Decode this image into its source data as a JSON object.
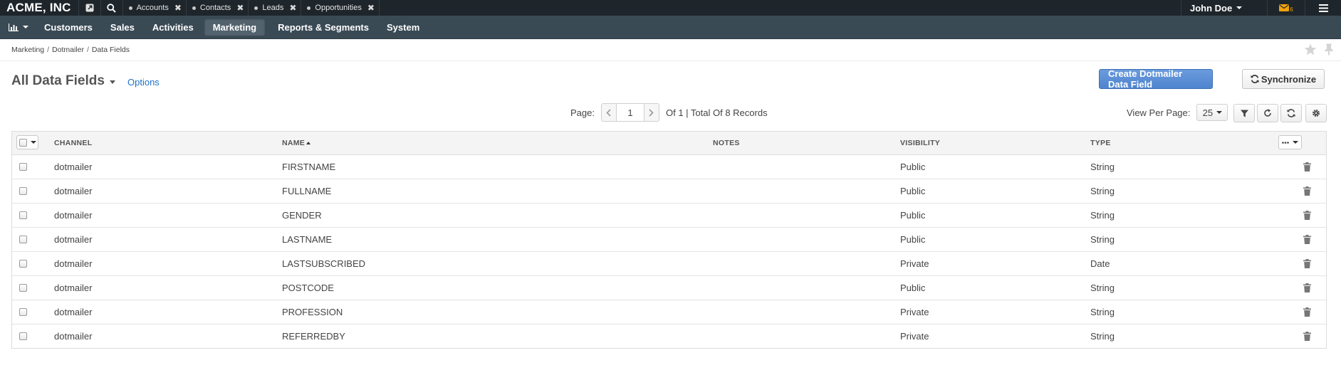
{
  "app": {
    "logo": "ACME, INC"
  },
  "pinned_tabs": [
    {
      "label": "Accounts"
    },
    {
      "label": "Contacts"
    },
    {
      "label": "Leads"
    },
    {
      "label": "Opportunities"
    }
  ],
  "user": {
    "name": "John Doe",
    "notification_count": "6"
  },
  "nav": {
    "items": [
      {
        "label": "Customers"
      },
      {
        "label": "Sales"
      },
      {
        "label": "Activities"
      },
      {
        "label": "Marketing",
        "active": true
      },
      {
        "label": "Reports & Segments"
      },
      {
        "label": "System"
      }
    ]
  },
  "breadcrumb": [
    "Marketing",
    "Dotmailer",
    "Data Fields"
  ],
  "page": {
    "title": "All Data Fields",
    "options_label": "Options",
    "create_button": "Create Dotmailer Data Field",
    "sync_button": "Synchronize"
  },
  "pager": {
    "label": "Page:",
    "current": "1",
    "total_text": "Of 1 | Total Of 8 Records",
    "per_page_label": "View Per Page:",
    "per_page": "25"
  },
  "grid": {
    "columns": [
      "CHANNEL",
      "NAME",
      "NOTES",
      "VISIBILITY",
      "TYPE"
    ],
    "rows": [
      {
        "channel": "dotmailer",
        "name": "FIRSTNAME",
        "notes": "",
        "visibility": "Public",
        "type": "String"
      },
      {
        "channel": "dotmailer",
        "name": "FULLNAME",
        "notes": "",
        "visibility": "Public",
        "type": "String"
      },
      {
        "channel": "dotmailer",
        "name": "GENDER",
        "notes": "",
        "visibility": "Public",
        "type": "String"
      },
      {
        "channel": "dotmailer",
        "name": "LASTNAME",
        "notes": "",
        "visibility": "Public",
        "type": "String"
      },
      {
        "channel": "dotmailer",
        "name": "LASTSUBSCRIBED",
        "notes": "",
        "visibility": "Private",
        "type": "Date"
      },
      {
        "channel": "dotmailer",
        "name": "POSTCODE",
        "notes": "",
        "visibility": "Public",
        "type": "String"
      },
      {
        "channel": "dotmailer",
        "name": "PROFESSION",
        "notes": "",
        "visibility": "Private",
        "type": "String"
      },
      {
        "channel": "dotmailer",
        "name": "REFERREDBY",
        "notes": "",
        "visibility": "Private",
        "type": "String"
      }
    ]
  },
  "colors": {
    "topbar": "#1e252b",
    "mainnav": "#3a4a55",
    "primary": "#5b8fd6",
    "link": "#1e70c7",
    "notification": "#f0a30a"
  },
  "icons": [
    "chart-icon",
    "external-link-icon",
    "search-icon",
    "close-icon",
    "envelope-icon",
    "hamburger-icon",
    "star-icon",
    "pin-icon",
    "sync-icon",
    "filter-icon",
    "refresh-icon",
    "reset-icon",
    "gear-icon",
    "ellipsis-icon",
    "trash-icon"
  ]
}
